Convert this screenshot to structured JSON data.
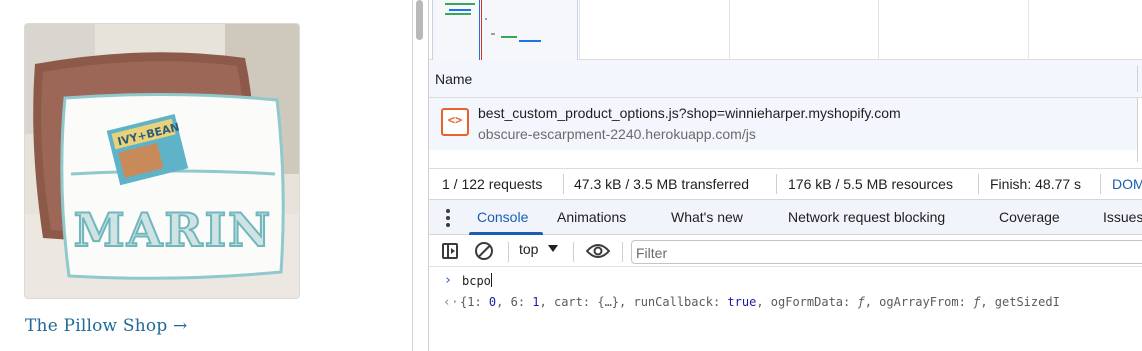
{
  "shop": {
    "image_alt": "White pillow with pocket holding a book, embroidered MARIN",
    "pillow_text": "MARIN",
    "book_title": "IVY+BEAN",
    "link_label": "The Pillow Shop →"
  },
  "network": {
    "column_name": "Name",
    "request": {
      "icon": "code-file-icon",
      "icon_glyph": "<>",
      "name": "best_custom_product_options.js?shop=winnieharper.myshopify.com",
      "domain": "obscure-escarpment-2240.herokuapp.com/js"
    },
    "summary": {
      "requests": "1 / 122 requests",
      "transferred": "47.3 kB / 3.5 MB transferred",
      "resources": "176 kB / 5.5 MB resources",
      "finish": "Finish: 48.77 s",
      "domcontentloaded": "DOM"
    }
  },
  "drawer": {
    "tabs": [
      {
        "label": "Console",
        "active": true
      },
      {
        "label": "Animations",
        "active": false
      },
      {
        "label": "What's new",
        "active": false
      },
      {
        "label": "Network request blocking",
        "active": false
      },
      {
        "label": "Coverage",
        "active": false
      },
      {
        "label": "Issues",
        "active": false
      }
    ]
  },
  "console": {
    "context": "top",
    "filter_placeholder": "Filter",
    "input_command": "bcpo",
    "output": {
      "open": "{",
      "k1": "1: ",
      "v1": "0",
      "c1": ", ",
      "k2": "6: ",
      "v2": "1",
      "c2": ", ",
      "k3": "cart: ",
      "v3": "{…}",
      "c3": ", ",
      "k4": "runCallback: ",
      "v4": "true",
      "c4": ", ",
      "k5": "ogFormData: ",
      "v5": "ƒ",
      "c5": ", ",
      "k6": "ogArrayFrom: ",
      "v6": "ƒ",
      "c6": ", ",
      "k7": "getSizedI"
    }
  },
  "colors": {
    "accent": "#1a5fb4",
    "link": "#1e6a96",
    "script_icon": "#e8622c",
    "selected_row": "#f3f6fc"
  }
}
